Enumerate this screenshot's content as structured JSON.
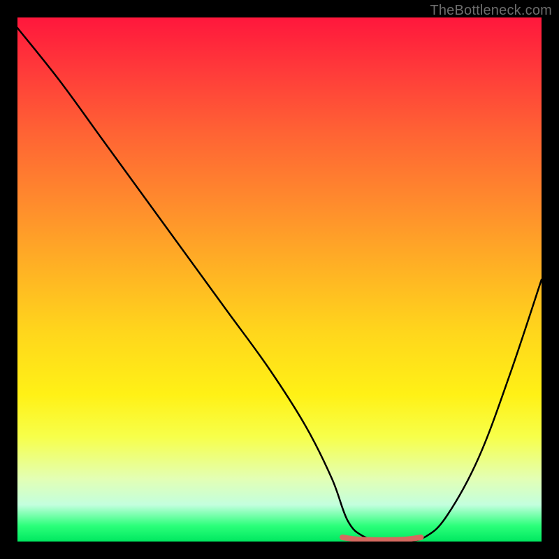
{
  "watermark": "TheBottleneck.com",
  "chart_data": {
    "type": "line",
    "title": "",
    "xlabel": "",
    "ylabel": "",
    "xlim": [
      0,
      100
    ],
    "ylim": [
      0,
      100
    ],
    "series": [
      {
        "name": "curve",
        "x": [
          0,
          8,
          16,
          24,
          32,
          40,
          48,
          55,
          60,
          63,
          66,
          70,
          74,
          78,
          82,
          88,
          94,
          100
        ],
        "y": [
          98,
          88,
          77,
          66,
          55,
          44,
          33,
          22,
          12,
          4,
          1,
          0,
          0,
          1,
          5,
          16,
          32,
          50
        ]
      },
      {
        "name": "flat-marker",
        "x": [
          62,
          65,
          68,
          71,
          74,
          77
        ],
        "y": [
          0.8,
          0.4,
          0.3,
          0.3,
          0.4,
          0.8
        ]
      }
    ],
    "colors": {
      "curve": "#000000",
      "flat_marker": "#d66a60",
      "gradient_top": "#ff173c",
      "gradient_bottom": "#00e860"
    }
  }
}
